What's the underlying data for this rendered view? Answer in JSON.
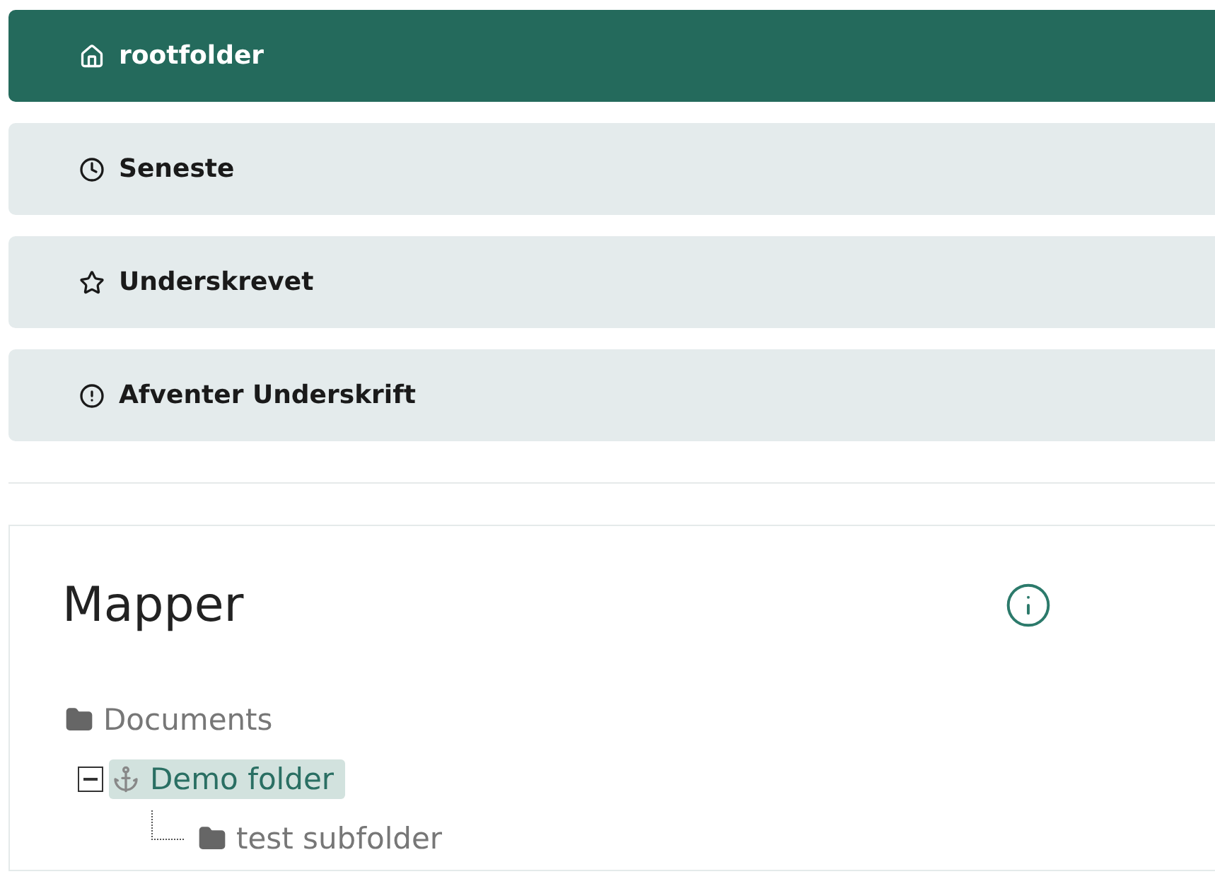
{
  "nav": [
    {
      "label": "rootfolder",
      "kind": "home",
      "selected": true
    },
    {
      "label": "Seneste",
      "kind": "clock",
      "selected": false
    },
    {
      "label": "Underskrevet",
      "kind": "star",
      "selected": false
    },
    {
      "label": "Afventer Underskrift",
      "kind": "alert",
      "selected": false
    }
  ],
  "folders": {
    "title": "Mapper",
    "tree": [
      {
        "label": "Documents",
        "kind": "folder",
        "selected": false,
        "children": [
          {
            "label": "Demo folder",
            "kind": "anchor",
            "selected": true,
            "expanded": true,
            "children": [
              {
                "label": "test subfolder",
                "kind": "folder",
                "selected": false
              }
            ]
          }
        ]
      }
    ]
  }
}
